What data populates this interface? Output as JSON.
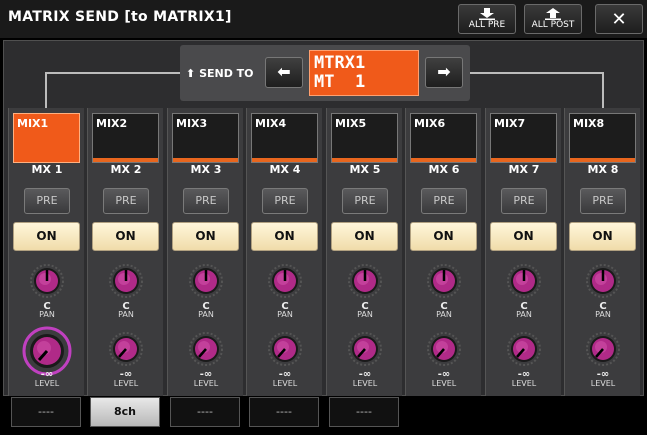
{
  "window": {
    "title": "MATRIX SEND [to MATRIX1]",
    "all_pre_label": "ALL PRE",
    "all_post_label": "ALL POST",
    "close_icon": "close-icon"
  },
  "send": {
    "label": "SEND TO",
    "prev_icon": "arrow-left-icon",
    "next_icon": "arrow-right-icon",
    "matrix_line1": "MTRX1",
    "matrix_line2": "MT  1"
  },
  "channels": [
    {
      "name": "MIX1",
      "short": "MX 1",
      "pre": "PRE",
      "on": "ON",
      "pan_value": "C",
      "pan_label": "PAN",
      "level_value": "-∞",
      "level_label": "LEVEL",
      "selected": true
    },
    {
      "name": "MIX2",
      "short": "MX 2",
      "pre": "PRE",
      "on": "ON",
      "pan_value": "C",
      "pan_label": "PAN",
      "level_value": "-∞",
      "level_label": "LEVEL",
      "selected": false
    },
    {
      "name": "MIX3",
      "short": "MX 3",
      "pre": "PRE",
      "on": "ON",
      "pan_value": "C",
      "pan_label": "PAN",
      "level_value": "-∞",
      "level_label": "LEVEL",
      "selected": false
    },
    {
      "name": "MIX4",
      "short": "MX 4",
      "pre": "PRE",
      "on": "ON",
      "pan_value": "C",
      "pan_label": "PAN",
      "level_value": "-∞",
      "level_label": "LEVEL",
      "selected": false
    },
    {
      "name": "MIX5",
      "short": "MX 5",
      "pre": "PRE",
      "on": "ON",
      "pan_value": "C",
      "pan_label": "PAN",
      "level_value": "-∞",
      "level_label": "LEVEL",
      "selected": false
    },
    {
      "name": "MIX6",
      "short": "MX 6",
      "pre": "PRE",
      "on": "ON",
      "pan_value": "C",
      "pan_label": "PAN",
      "level_value": "-∞",
      "level_label": "LEVEL",
      "selected": false
    },
    {
      "name": "MIX7",
      "short": "MX 7",
      "pre": "PRE",
      "on": "ON",
      "pan_value": "C",
      "pan_label": "PAN",
      "level_value": "-∞",
      "level_label": "LEVEL",
      "selected": false
    },
    {
      "name": "MIX8",
      "short": "MX 8",
      "pre": "PRE",
      "on": "ON",
      "pan_value": "C",
      "pan_label": "PAN",
      "level_value": "-∞",
      "level_label": "LEVEL",
      "selected": false
    }
  ],
  "bottom_tabs": [
    "----",
    "8ch",
    "----",
    "----",
    "----"
  ],
  "active_tab": "8ch",
  "colors": {
    "accent_orange": "#f05a1a",
    "knob_purple": "#a0207a",
    "on_button": "#f5e6bc"
  }
}
